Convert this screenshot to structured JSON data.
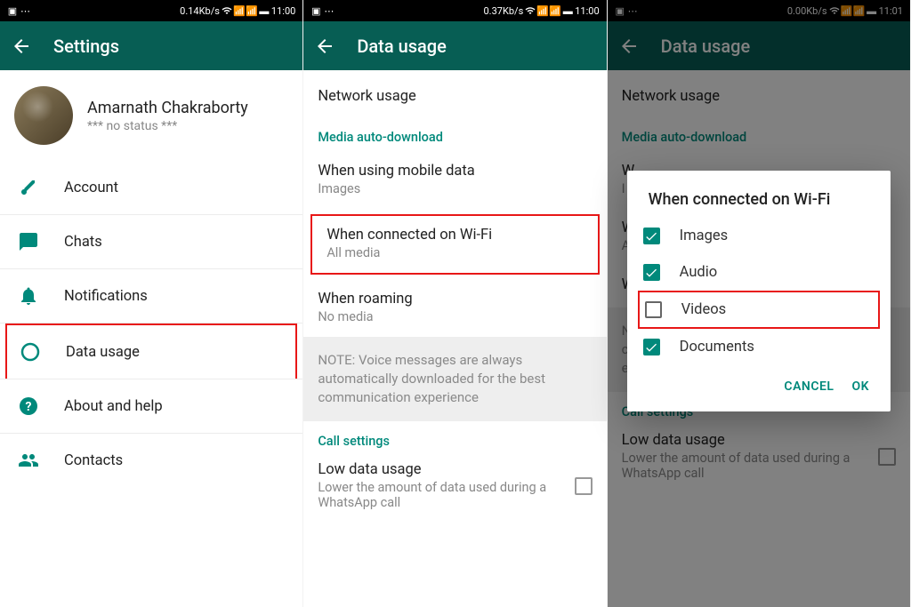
{
  "screen1": {
    "statusbar": {
      "speed": "0.14Kb/s",
      "time": "11:00"
    },
    "appbar": {
      "title": "Settings"
    },
    "profile": {
      "name": "Amarnath Chakraborty",
      "status": "*** no status ***"
    },
    "items": [
      {
        "icon": "key",
        "label": "Account"
      },
      {
        "icon": "chat",
        "label": "Chats"
      },
      {
        "icon": "bell",
        "label": "Notifications"
      },
      {
        "icon": "data",
        "label": "Data usage"
      },
      {
        "icon": "help",
        "label": "About and help"
      },
      {
        "icon": "contacts",
        "label": "Contacts"
      }
    ]
  },
  "screen2": {
    "statusbar": {
      "speed": "0.37Kb/s",
      "time": "11:00"
    },
    "appbar": {
      "title": "Data usage"
    },
    "network_usage": "Network usage",
    "media_header": "Media auto-download",
    "rows": [
      {
        "title": "When using mobile data",
        "sub": "Images"
      },
      {
        "title": "When connected on Wi-Fi",
        "sub": "All media"
      },
      {
        "title": "When roaming",
        "sub": "No media"
      }
    ],
    "note": "NOTE: Voice messages are always automatically downloaded for the best communication experience",
    "call_header": "Call settings",
    "low_data": {
      "title": "Low data usage",
      "sub": "Lower the amount of data used during a WhatsApp call"
    }
  },
  "screen3": {
    "statusbar": {
      "speed": "0.00Kb/s",
      "time": "11:01"
    },
    "appbar": {
      "title": "Data usage"
    },
    "network_usage": "Network usage",
    "media_header": "Media auto-download",
    "rows": [
      {
        "title": "W",
        "sub": "I"
      },
      {
        "title": "W",
        "sub": "A"
      },
      {
        "title": "W",
        "sub": ""
      }
    ],
    "note_trunc": [
      "N",
      "c",
      "e"
    ],
    "call_header": "Call settings",
    "low_data": {
      "title": "Low data usage",
      "sub": "Lower the amount of data used during a WhatsApp call"
    },
    "dialog": {
      "title": "When connected on Wi-Fi",
      "options": [
        {
          "label": "Images",
          "checked": true
        },
        {
          "label": "Audio",
          "checked": true
        },
        {
          "label": "Videos",
          "checked": false
        },
        {
          "label": "Documents",
          "checked": true
        }
      ],
      "cancel": "CANCEL",
      "ok": "OK"
    }
  }
}
